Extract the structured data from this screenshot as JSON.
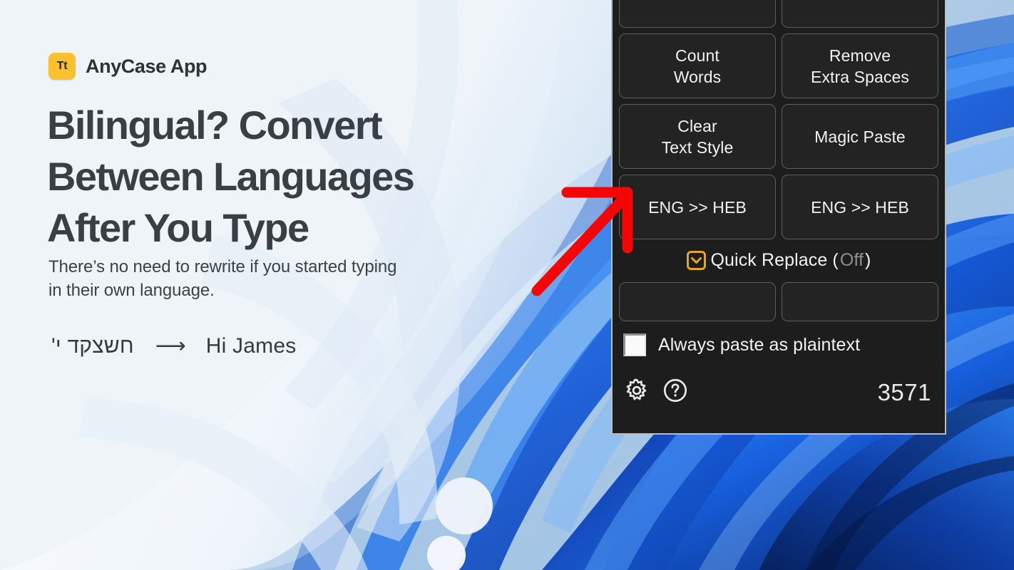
{
  "background": {
    "promo_bg_color": "#e9eff6",
    "wallpaper_name": "windows-11-bloom-wallpaper",
    "wallpaper_sky_color": "#a9c9e6",
    "ribbon_colors": [
      "#0a2f8f",
      "#1358d8",
      "#2a86f5",
      "#0b3fb0",
      "#07245f"
    ]
  },
  "promo": {
    "brand": {
      "logo_text": "Tt",
      "logo_color": "#fbc02d",
      "name": "AnyCase App"
    },
    "headline": "Bilingual? Convert Between Languages After You Type",
    "subhead": "There’s no need to rewrite if you started typing in their own language.",
    "example": {
      "source_text": "חשצקד י'",
      "arrow": "⟶",
      "result_text": "Hi James"
    }
  },
  "annotation": {
    "arrow_color": "#f50505",
    "arrow_name": "red-pointer-arrow"
  },
  "app_panel": {
    "panel_bg": "#1d1d1d",
    "border_color": "#b9bcc0",
    "accent_color": "#e3a81d",
    "tiles": [
      {
        "line1": "",
        "line2": "",
        "name": "tile-cutoff-left",
        "cutoff": true
      },
      {
        "line1": "",
        "line2": "",
        "name": "tile-cutoff-right",
        "cutoff": true
      },
      {
        "line1": "Count",
        "line2": "Words",
        "name": "tile-count-words"
      },
      {
        "line1": "Remove",
        "line2": "Extra Spaces",
        "name": "tile-remove-extra-spaces"
      },
      {
        "line1": "Clear",
        "line2": "Text Style",
        "name": "tile-clear-text-style"
      },
      {
        "line1": "Magic Paste",
        "line2": "",
        "name": "tile-magic-paste"
      },
      {
        "line1": "ENG >> HEB",
        "line2": "",
        "name": "tile-eng-heb-left"
      },
      {
        "line1": "ENG >> HEB",
        "line2": "",
        "name": "tile-eng-heb-right"
      }
    ],
    "quick_replace": {
      "label": "Quick Replace (",
      "state": "Off",
      "label_end": ")",
      "checked": true
    },
    "empty_tiles": [
      {
        "label": "",
        "name": "tile-empty-left"
      },
      {
        "label": "",
        "name": "tile-empty-right"
      }
    ],
    "plaintext": {
      "label": "Always paste as plaintext",
      "checked": false
    },
    "footer": {
      "settings_icon": "gear-icon",
      "help_icon": "question-circle-icon",
      "counter": "3571"
    }
  }
}
